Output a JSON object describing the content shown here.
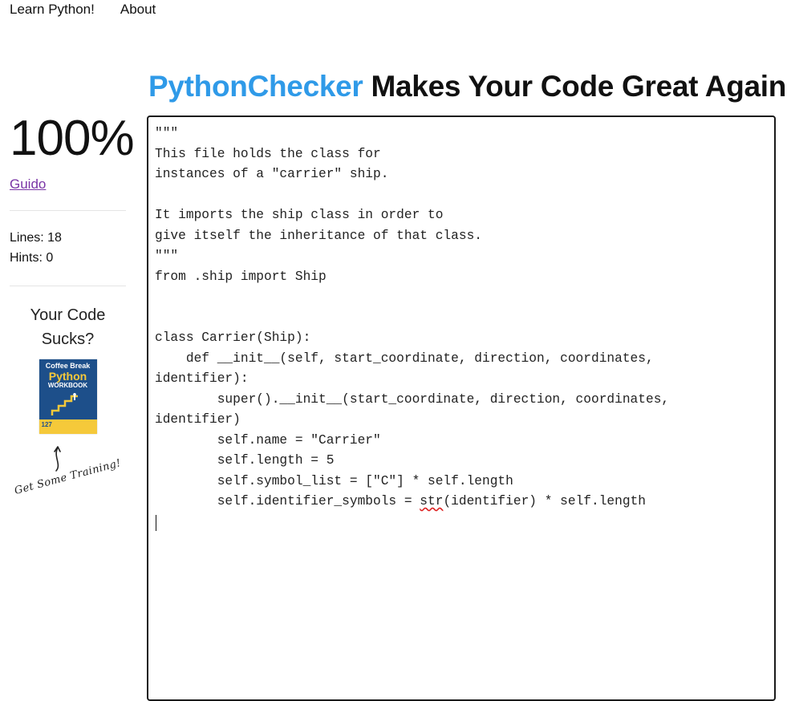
{
  "nav": {
    "items": [
      {
        "label": "Learn Python!"
      },
      {
        "label": "About"
      }
    ]
  },
  "header": {
    "brand": "PythonChecker",
    "tagline": " Makes Your Code Great Again",
    "brand_color": "#2f9ae8"
  },
  "sidebar": {
    "score": "100%",
    "user_link": "Guido",
    "lines_label": "Lines: 18",
    "hints_label": "Hints: 0",
    "promo_title": "Your Code Sucks?",
    "book": {
      "line1": "Coffee Break",
      "line2": "Python",
      "line3": "WORKBOOK",
      "badge": "127"
    },
    "training_text": "Get Some Training!"
  },
  "editor": {
    "line1": "\"\"\"",
    "line2": "This file holds the class for",
    "line3": "instances of a \"carrier\" ship.",
    "line4": "",
    "line5": "It imports the ship class in order to",
    "line6": "give itself the inheritance of that class.",
    "line7": "\"\"\"",
    "line8": "from .ship import Ship",
    "line9": "",
    "line10": "",
    "line11": "class Carrier(Ship):",
    "line12": "    def __init__(self, start_coordinate, direction, coordinates,",
    "line13": "identifier):",
    "line14": "        super().__init__(start_coordinate, direction, coordinates,",
    "line15": "identifier)",
    "line16": "        self.name = \"Carrier\"",
    "line17": "        self.length = 5",
    "line18": "        self.symbol_list = [\"C\"] * self.length",
    "line19_pre": "        self.identifier_symbols = ",
    "line19_flag": "str",
    "line19_post": "(identifier) * self.length"
  }
}
